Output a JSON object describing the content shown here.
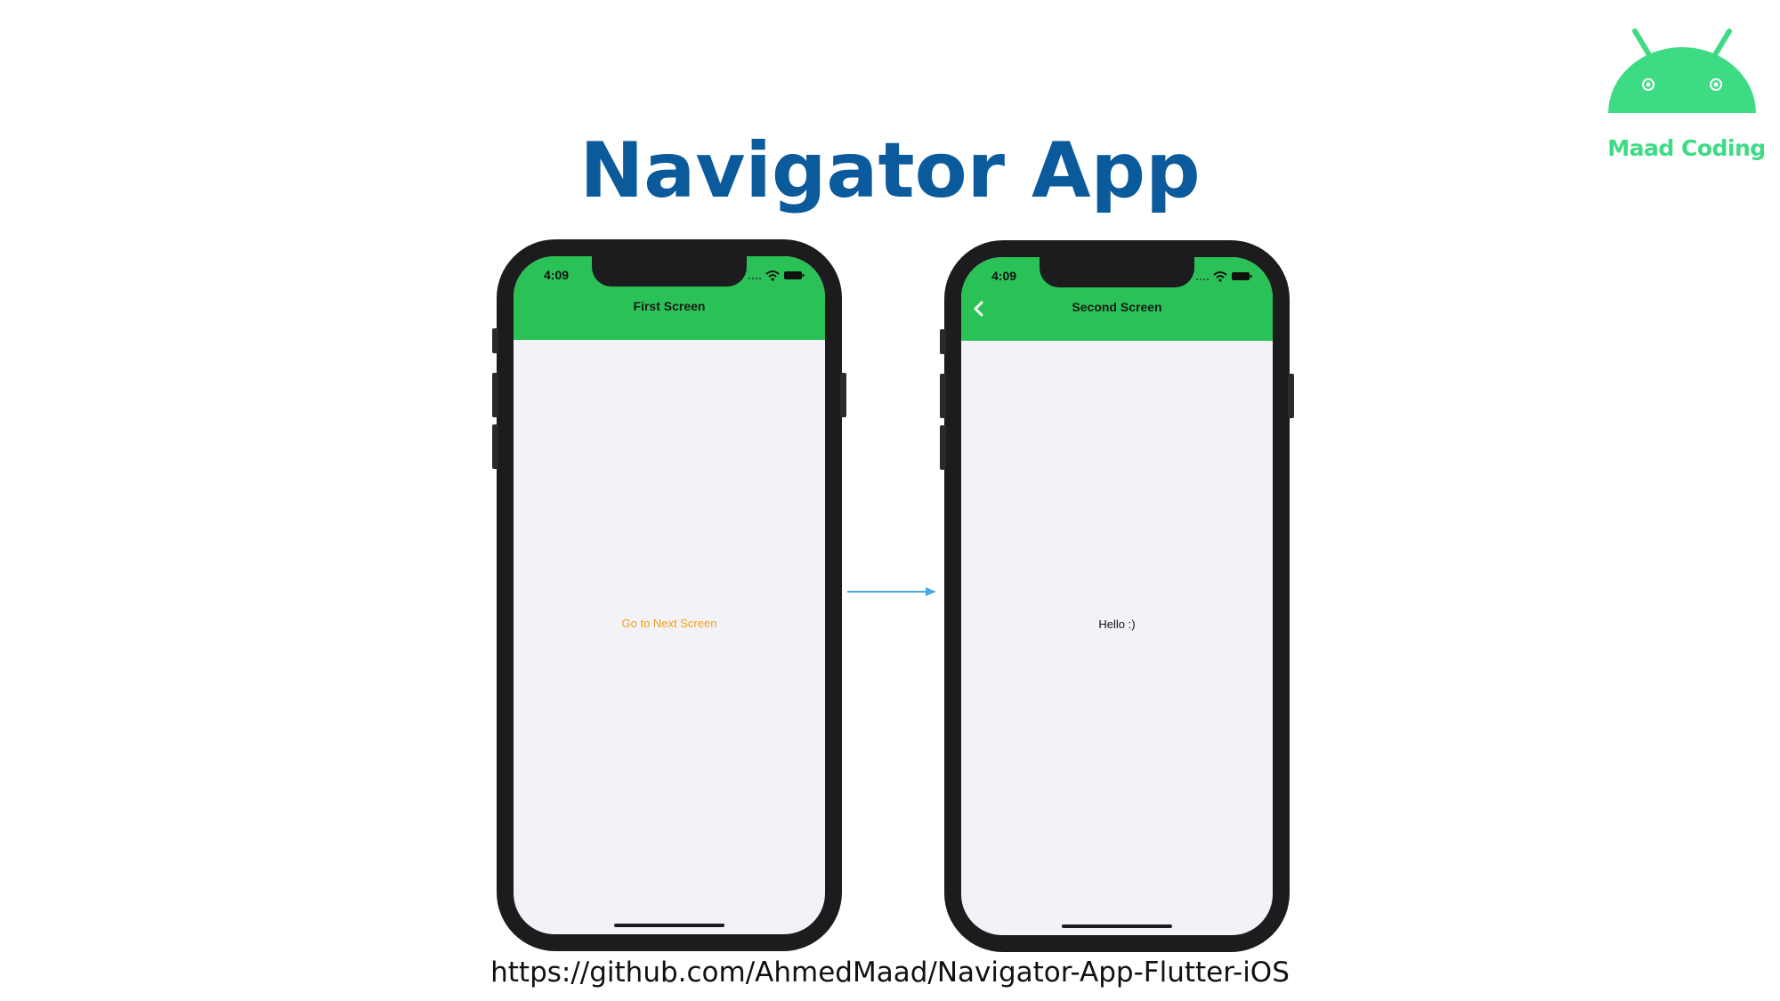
{
  "slide": {
    "title": "Navigator App",
    "url": "https://github.com/AhmedMaad/Navigator-App-Flutter-iOS"
  },
  "logo": {
    "text": "Maad Coding",
    "color": "#3ddc84",
    "icon": "android-robot-icon"
  },
  "colors": {
    "title": "#0b5a9b",
    "appbar": "#2ac256",
    "link": "#f0a21a",
    "arrow": "#4aa9e0"
  },
  "phones": {
    "first": {
      "time": "4:09",
      "appbar_title": "First Screen",
      "button_label": "Go to Next Screen"
    },
    "second": {
      "time": "4:09",
      "appbar_title": "Second Screen",
      "body_text": "Hello :)",
      "back_icon": "chevron-left-icon"
    }
  }
}
